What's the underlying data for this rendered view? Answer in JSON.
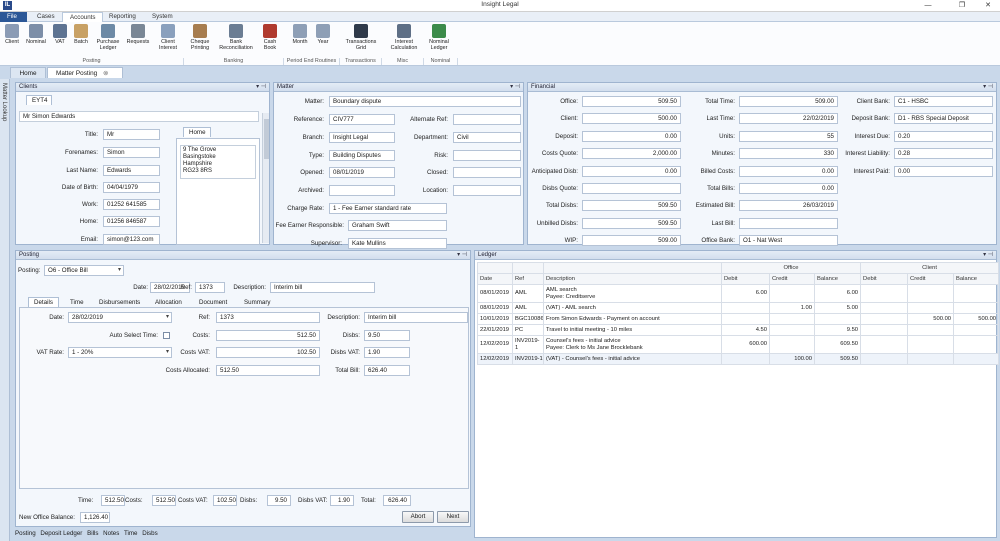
{
  "window": {
    "title": "Insight Legal",
    "app_icon": "IL"
  },
  "menu": {
    "file": "File",
    "tabs": [
      "Cases",
      "Accounts",
      "Reporting",
      "System"
    ],
    "active": "Accounts"
  },
  "ribbon": {
    "buttons": [
      {
        "label": "Client",
        "icon": "client-icon"
      },
      {
        "label": "Nominal",
        "icon": "nominal-icon"
      },
      {
        "label": "VAT",
        "icon": "vat-icon"
      },
      {
        "label": "Batch",
        "icon": "batch-icon"
      },
      {
        "label": "Purchase\nLedger",
        "icon": "purchase-ledger-icon"
      },
      {
        "label": "Requests",
        "icon": "requests-icon"
      },
      {
        "label": "Client\nInterest",
        "icon": "client-interest-icon"
      },
      {
        "label": "Cheque\nPrinting",
        "icon": "cheque-printing-icon"
      },
      {
        "label": "Bank\nReconciliation",
        "icon": "bank-reconciliation-icon"
      },
      {
        "label": "Cash\nBook",
        "icon": "cash-book-icon"
      },
      {
        "label": "Month",
        "icon": "month-icon"
      },
      {
        "label": "Year",
        "icon": "year-icon"
      },
      {
        "label": "Transactions\nGrid",
        "icon": "transactions-grid-icon"
      },
      {
        "label": "Interest\nCalculation",
        "icon": "interest-calculation-icon"
      },
      {
        "label": "Nominal\nLedger",
        "icon": "nominal-ledger-icon"
      }
    ],
    "groups": [
      "Posting",
      "Banking",
      "Period End Routines",
      "Transactions",
      "Misc",
      "Nominal"
    ]
  },
  "doc_tabs": [
    "Home",
    "Matter Posting"
  ],
  "side_strip": "Matter Lookup",
  "clients": {
    "title": "Clients",
    "tab": "EYT4",
    "name": "Mr Simon Edwards",
    "fields": [
      {
        "label": "Title:",
        "value": "Mr"
      },
      {
        "label": "Forenames:",
        "value": "Simon"
      },
      {
        "label": "Last Name:",
        "value": "Edwards"
      },
      {
        "label": "Date of Birth:",
        "value": "04/04/1979"
      },
      {
        "label": "Work:",
        "value": "01252 641585"
      },
      {
        "label": "Home:",
        "value": "01256 846587"
      },
      {
        "label": "Email:",
        "value": "simon@123.com"
      }
    ],
    "address_tab": "Home",
    "address": [
      "9 The Grove",
      "Basingstoke",
      "Hampshire",
      "RG23 8RS"
    ]
  },
  "matter": {
    "title": "Matter",
    "matter_label": "Matter:",
    "matter_value": "Boundary dispute",
    "left": [
      {
        "label": "Reference:",
        "value": "CIV777"
      },
      {
        "label": "Branch:",
        "value": "Insight Legal"
      },
      {
        "label": "Type:",
        "value": "Building Disputes"
      },
      {
        "label": "Opened:",
        "value": "08/01/2019"
      },
      {
        "label": "Archived:",
        "value": ""
      }
    ],
    "right": [
      {
        "label": "Alternate Ref:",
        "value": ""
      },
      {
        "label": "Department:",
        "value": "Civil"
      },
      {
        "label": "Risk:",
        "value": ""
      },
      {
        "label": "Closed:",
        "value": ""
      },
      {
        "label": "Location:",
        "value": ""
      }
    ],
    "bottom": [
      {
        "label": "Charge Rate:",
        "value": "1 - Fee Earner standard rate"
      },
      {
        "label": "Fee Earner Responsible:",
        "value": "Graham Swift"
      },
      {
        "label": "Supervisor:",
        "value": "Kate Mullins"
      }
    ]
  },
  "financial": {
    "title": "Financial",
    "col1": [
      {
        "label": "Office:",
        "value": "509.50"
      },
      {
        "label": "Client:",
        "value": "500.00"
      },
      {
        "label": "Deposit:",
        "value": "0.00"
      },
      {
        "label": "Costs Quote:",
        "value": "2,000.00"
      },
      {
        "label": "Anticipated Disb:",
        "value": "0.00"
      },
      {
        "label": "Disbs Quote:",
        "value": ""
      },
      {
        "label": "Total Disbs:",
        "value": "509.50"
      },
      {
        "label": "Unbilled Disbs:",
        "value": "509.50"
      },
      {
        "label": "WIP:",
        "value": "509.00"
      }
    ],
    "col2": [
      {
        "label": "Total Time:",
        "value": "509.00"
      },
      {
        "label": "Last Time:",
        "value": "22/02/2019"
      },
      {
        "label": "Units:",
        "value": "55"
      },
      {
        "label": "Minutes:",
        "value": "330"
      },
      {
        "label": "Billed Costs:",
        "value": "0.00"
      },
      {
        "label": "Total Bills:",
        "value": "0.00"
      },
      {
        "label": "Estimated Bill:",
        "value": "26/03/2019"
      },
      {
        "label": "Last Bill:",
        "value": ""
      },
      {
        "label": "Office Bank:",
        "value": "O1 - Nat West"
      }
    ],
    "col3": [
      {
        "label": "Client Bank:",
        "value": "C1 - HSBC"
      },
      {
        "label": "Deposit Bank:",
        "value": "D1 - RBS Special Deposit"
      },
      {
        "label": "Interest Due:",
        "value": "0.20"
      },
      {
        "label": "Interest Liability:",
        "value": "0.28"
      },
      {
        "label": "Interest Paid:",
        "value": "0.00"
      }
    ]
  },
  "posting": {
    "title": "Posting",
    "posting_label": "Posting:",
    "posting_value": "O6 - Office Bill",
    "date_label": "Date:",
    "date": "28/02/2019",
    "ref_label": "Ref:",
    "ref": "1373",
    "desc_label": "Description:",
    "desc": "Interim bill",
    "tabs": [
      "Details",
      "Time",
      "Disbursements",
      "Allocation",
      "Document",
      "Summary"
    ],
    "details": {
      "date_label": "Date:",
      "date": "28/02/2019",
      "auto_select_label": "Auto Select Time:",
      "vat_rate_label": "VAT Rate:",
      "vat_rate": "1 - 20%",
      "ref_label": "Ref:",
      "ref": "1373",
      "costs_label": "Costs:",
      "costs": "512.50",
      "costs_vat_label": "Costs VAT:",
      "costs_vat": "102.50",
      "costs_alloc_label": "Costs Allocated:",
      "costs_alloc": "512.50",
      "desc_label": "Description:",
      "desc": "Interim bill",
      "disbs_label": "Disbs:",
      "disbs": "9.50",
      "disbs_vat_label": "Disbs VAT:",
      "disbs_vat": "1.90",
      "total_bill_label": "Total Bill:",
      "total_bill": "626.40"
    },
    "summary": [
      {
        "label": "Time:",
        "value": "512.50"
      },
      {
        "label": "Costs:",
        "value": "512.50"
      },
      {
        "label": "Costs VAT:",
        "value": "102.50"
      },
      {
        "label": "Disbs:",
        "value": "9.50"
      },
      {
        "label": "Disbs VAT:",
        "value": "1.90"
      },
      {
        "label": "Total:",
        "value": "626.40"
      }
    ],
    "new_balance_label": "New Office Balance:",
    "new_balance": "1,126.40",
    "abort": "Abort",
    "next": "Next"
  },
  "bottom_tabs": [
    "Posting",
    "Deposit Ledger",
    "Bills",
    "Notes",
    "Time",
    "Disbs"
  ],
  "ledger": {
    "title": "Ledger",
    "office_group": "Office",
    "client_group": "Client",
    "columns": [
      "Date",
      "Ref",
      "Description",
      "Debit",
      "Credit",
      "Balance",
      "Debit",
      "Credit",
      "Balance"
    ],
    "rows": [
      [
        "08/01/2019",
        "AML",
        "AML search\nPayee: Creditserve",
        "6.00",
        "",
        "6.00",
        "",
        "",
        ""
      ],
      [
        "08/01/2019",
        "AML",
        "(VAT) - AML search",
        "",
        "1.00",
        "5.00",
        "",
        "",
        ""
      ],
      [
        "10/01/2019",
        "BGC10086",
        "From Simon Edwards - Payment on account",
        "",
        "",
        "",
        "",
        "500.00",
        "500.00"
      ],
      [
        "22/01/2019",
        "PC",
        "Travel to initial meeting - 10 miles",
        "4.50",
        "",
        "9.50",
        "",
        "",
        ""
      ],
      [
        "12/02/2019",
        "INV2019-1",
        "Counsel's fees - initial advice\nPayee: Clerk to Ms Jane Brocklebank",
        "600.00",
        "",
        "609.50",
        "",
        "",
        ""
      ],
      [
        "12/02/2019",
        "INV2019-1",
        "(VAT) - Counsel's fees - initial advice",
        "",
        "100.00",
        "509.50",
        "",
        "",
        ""
      ]
    ]
  }
}
